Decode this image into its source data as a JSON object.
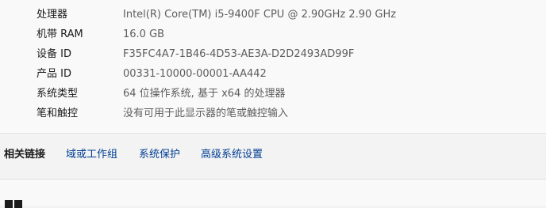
{
  "device_specs": {
    "rows": [
      {
        "label": "处理器",
        "value": "Intel(R) Core(TM) i5-9400F CPU @ 2.90GHz   2.90 GHz"
      },
      {
        "label": "机带 RAM",
        "value": "16.0 GB"
      },
      {
        "label": "设备 ID",
        "value": "F35FC4A7-1B46-4D53-AE3A-D2D2493AD99F"
      },
      {
        "label": "产品 ID",
        "value": "00331-10000-00001-AA442"
      },
      {
        "label": "系统类型",
        "value": "64 位操作系统, 基于 x64 的处理器"
      },
      {
        "label": "笔和触控",
        "value": "没有可用于此显示器的笔或触控输入"
      }
    ]
  },
  "related_links": {
    "title": "相关链接",
    "links": [
      {
        "label": "域或工作组"
      },
      {
        "label": "系统保护"
      },
      {
        "label": "高级系统设置"
      }
    ]
  },
  "icons": {
    "windows": "windows-logo-icon"
  }
}
